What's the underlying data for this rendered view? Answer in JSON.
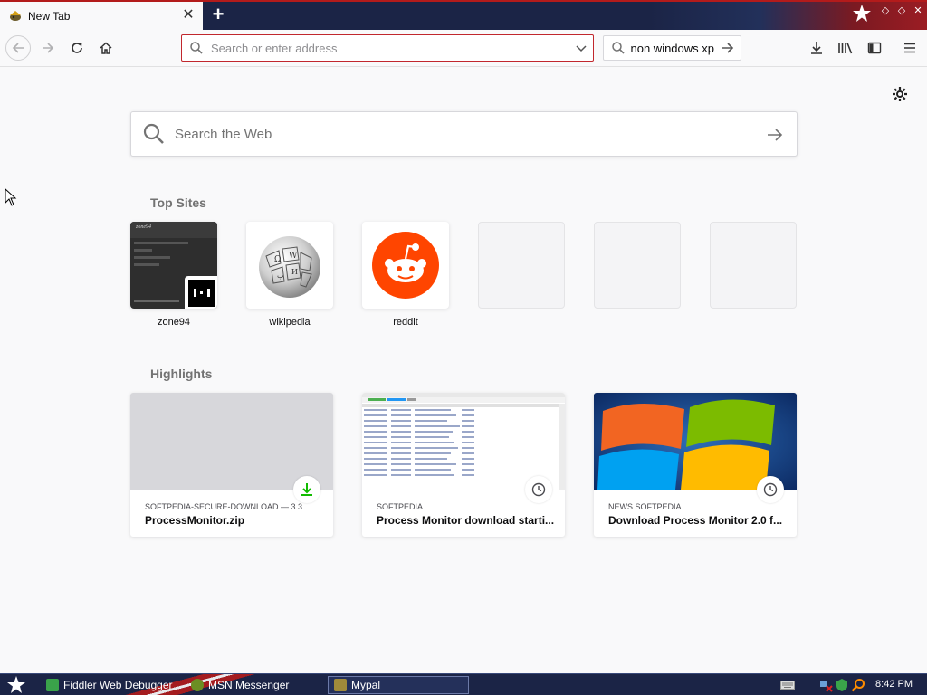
{
  "tab": {
    "title": "New Tab"
  },
  "toolbar": {
    "url_placeholder": "Search or enter address",
    "searchbar_text": "non windows xp"
  },
  "newtab": {
    "search_placeholder": "Search the Web",
    "top_sites_title": "Top Sites",
    "top_sites": [
      {
        "label": "zone94"
      },
      {
        "label": "wikipedia"
      },
      {
        "label": "reddit"
      },
      {
        "label": ""
      },
      {
        "label": ""
      },
      {
        "label": ""
      }
    ],
    "highlights_title": "Highlights",
    "highlights": [
      {
        "source": "SOFTPEDIA-SECURE-DOWNLOAD — 3.3 ...",
        "title": "ProcessMonitor.zip",
        "badge": "download-icon"
      },
      {
        "source": "SOFTPEDIA",
        "title": "Process Monitor download starti...",
        "badge": "clock-icon"
      },
      {
        "source": "NEWS.SOFTPEDIA",
        "title": "Download Process Monitor 2.0 f...",
        "badge": "clock-icon"
      }
    ]
  },
  "taskbar": {
    "items": [
      {
        "label": "Fiddler Web Debugger"
      },
      {
        "label": "MSN Messenger"
      },
      {
        "label": "Mypal"
      }
    ],
    "clock": "8:42 PM"
  },
  "colors": {
    "urlbar_border": "#c1272d",
    "reddit_orange": "#ff4500",
    "taskbar_bg": "#1b2446",
    "download_green": "#12bc00"
  }
}
